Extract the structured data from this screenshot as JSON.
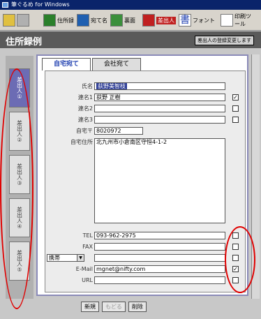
{
  "window": {
    "title": "筆ぐるめ for Windows"
  },
  "toolbar": {
    "items": [
      {
        "label": "住所録",
        "color": "#2a7f2a"
      },
      {
        "label": "宛て名",
        "color": "#1f5fb0"
      },
      {
        "label": "裏面",
        "color": "#3c8f3c"
      },
      {
        "label": "差出人",
        "color": "#c02020"
      },
      {
        "label": "フォント",
        "color": "#1f3fb0"
      },
      {
        "label": "印刷ツール",
        "color": "#4a4a4a"
      }
    ]
  },
  "header": {
    "title": "住所録例",
    "badge": "差出人の登録変更します"
  },
  "tabs": [
    {
      "label": "自宅宛て"
    },
    {
      "label": "会社宛て"
    }
  ],
  "sidebar": {
    "tabs": [
      {
        "label": "差出人①"
      },
      {
        "label": "差出人②"
      },
      {
        "label": "差出人③"
      },
      {
        "label": "差出人④"
      },
      {
        "label": "差出人⑤"
      }
    ]
  },
  "form": {
    "name": {
      "label": "氏名",
      "value": "荻野美智枝"
    },
    "joint1": {
      "label": "連名1",
      "value": "荻野 正樹",
      "checked": "✓"
    },
    "joint2": {
      "label": "連名2",
      "value": ""
    },
    "joint3": {
      "label": "連名3",
      "value": ""
    },
    "zip": {
      "label": "自宅〒",
      "value": "8020972"
    },
    "address": {
      "label": "自宅住所",
      "value": "北九州市小倉南区守恒4-1-2"
    },
    "tel": {
      "label": "TEL",
      "value": "093-962-2975"
    },
    "fax": {
      "label": "FAX",
      "value": ""
    },
    "phone": {
      "label": "携帯",
      "arrow": "▼",
      "value": ""
    },
    "email": {
      "label": "E-Mail",
      "value": "mgnet@nifty.com",
      "checked": "✓"
    },
    "url": {
      "label": "URL",
      "value": ""
    }
  },
  "bottom": {
    "new": "新規",
    "back": "もどる",
    "delete": "削除"
  }
}
